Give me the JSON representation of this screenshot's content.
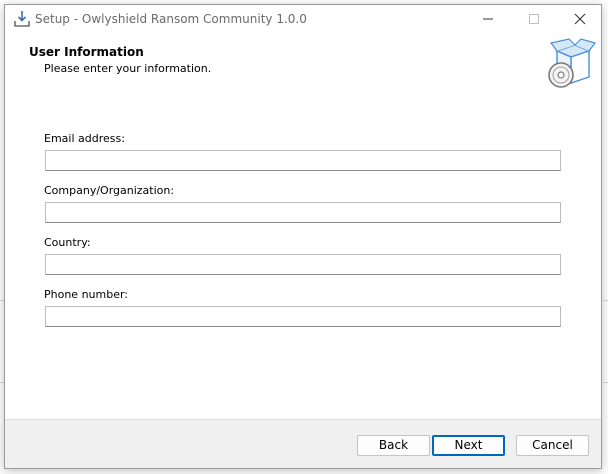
{
  "window": {
    "title": "Setup - Owlyshield Ransom Community 1.0.0",
    "controls": {
      "minimize": "minimize-icon",
      "maximize": "maximize-icon",
      "close": "close-icon"
    }
  },
  "header": {
    "title": "User Information",
    "subtitle": "Please enter your information.",
    "graphic": "package-disc-icon"
  },
  "form": {
    "fields": [
      {
        "label": "Email address:",
        "value": "",
        "placeholder": ""
      },
      {
        "label": "Company/Organization:",
        "value": "",
        "placeholder": ""
      },
      {
        "label": "Country:",
        "value": "",
        "placeholder": ""
      },
      {
        "label": "Phone number:",
        "value": "",
        "placeholder": ""
      }
    ]
  },
  "footer": {
    "back_label": "Back",
    "next_label": "Next",
    "cancel_label": "Cancel"
  },
  "colors": {
    "accent": "#0067c0",
    "window_bg": "#ffffff",
    "footer_bg": "#f0f0f0"
  }
}
